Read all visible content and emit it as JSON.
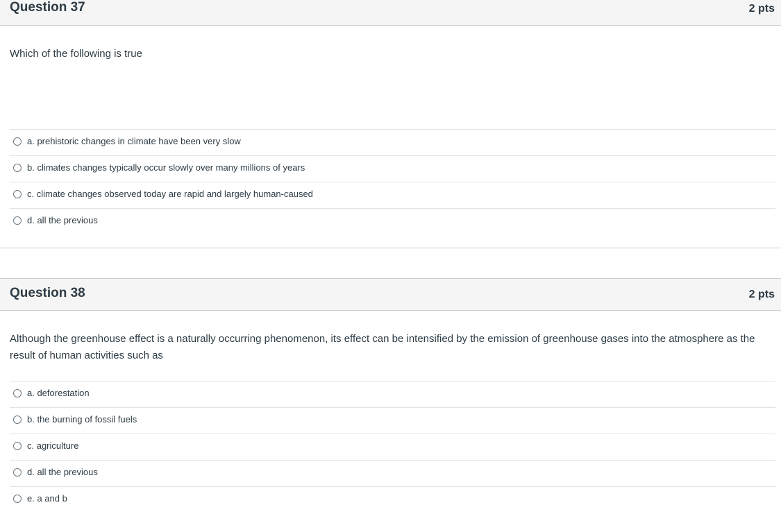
{
  "questions": [
    {
      "title": "Question 37",
      "points": "2 pts",
      "text": "Which of the following is true",
      "answers": [
        "a. prehistoric changes in climate have been very slow",
        "b. climates changes typically occur slowly over many millions of years",
        "c. climate changes observed today are rapid and largely human-caused",
        "d. all the previous"
      ]
    },
    {
      "title": "Question 38",
      "points": "2 pts",
      "text": "Although the greenhouse effect is a naturally occurring phenomenon, its effect can be intensified by the emission of greenhouse gases into the atmosphere as the result of human activities such as",
      "answers": [
        "a. deforestation",
        "b. the burning of fossil fuels",
        "c. agriculture",
        "d. all the previous",
        "e. a and b"
      ]
    }
  ]
}
